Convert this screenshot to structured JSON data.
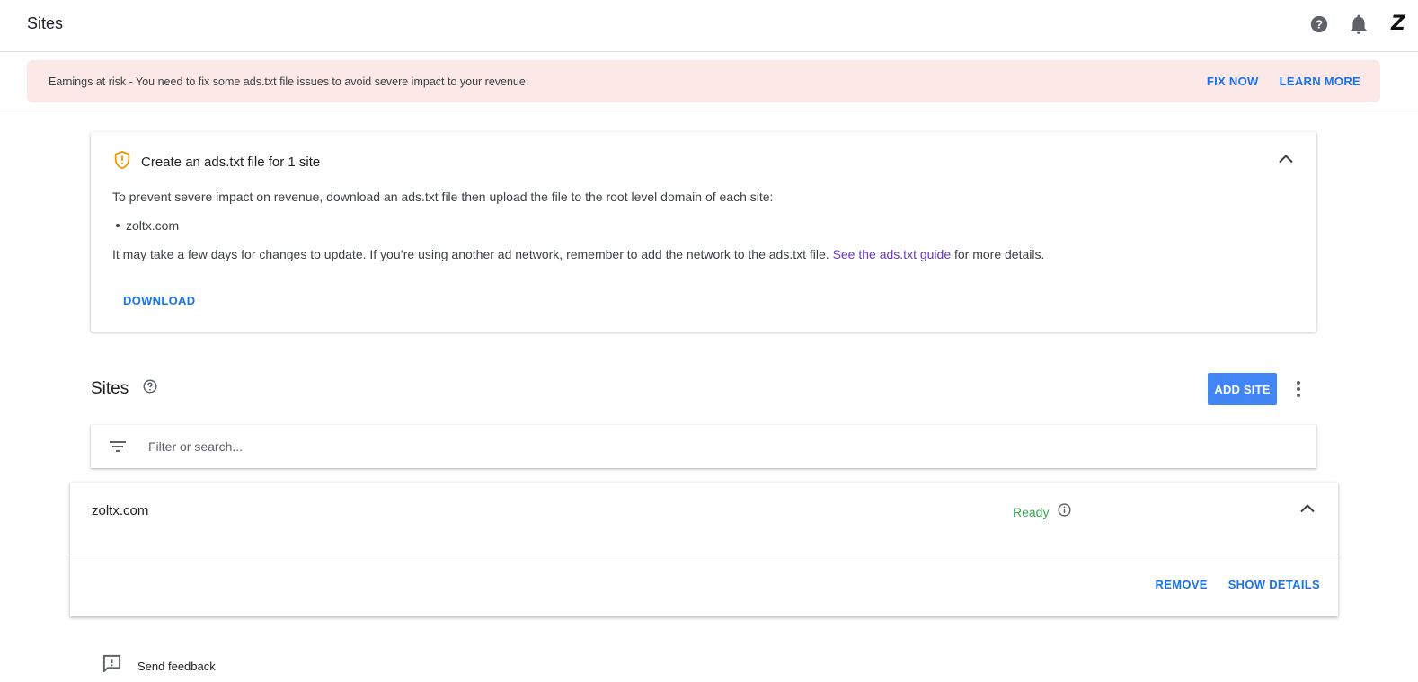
{
  "header": {
    "title": "Sites",
    "help_icon": "help-circle-icon",
    "notifications_icon": "bell-icon",
    "avatar_letter": "Z"
  },
  "banner": {
    "message": "Earnings at risk - You need to fix some ads.txt file issues to avoid severe impact to your revenue.",
    "fix_now_label": "FIX NOW",
    "learn_more_label": "LEARN MORE",
    "background_color": "#fce8e6"
  },
  "ads_card": {
    "heading": "Create an ads.txt file for 1 site",
    "instruction": "To prevent severe impact on revenue, download an ads.txt file then upload the file to the root level domain of each site:",
    "sites": [
      "zoltx.com"
    ],
    "note_before_link": "It may take a few days for changes to update. If you’re using another ad network, remember to add the network to the ads.txt file. ",
    "link_text": "See the ads.txt guide",
    "note_after_link": " for more details.",
    "download_label": "DOWNLOAD"
  },
  "sites_section": {
    "title": "Sites",
    "add_site_label": "ADD SITE",
    "filter_placeholder": "Filter or search..."
  },
  "site_row": {
    "domain": "zoltx.com",
    "status": "Ready",
    "remove_label": "REMOVE",
    "show_details_label": "SHOW DETAILS"
  },
  "footer": {
    "feedback_label": "Send feedback"
  },
  "colors": {
    "primary": "#1a73e8",
    "add_button": "#4285f4",
    "status_ready": "#34a853",
    "warning_icon": "#f29900",
    "link": "#673ab7"
  }
}
